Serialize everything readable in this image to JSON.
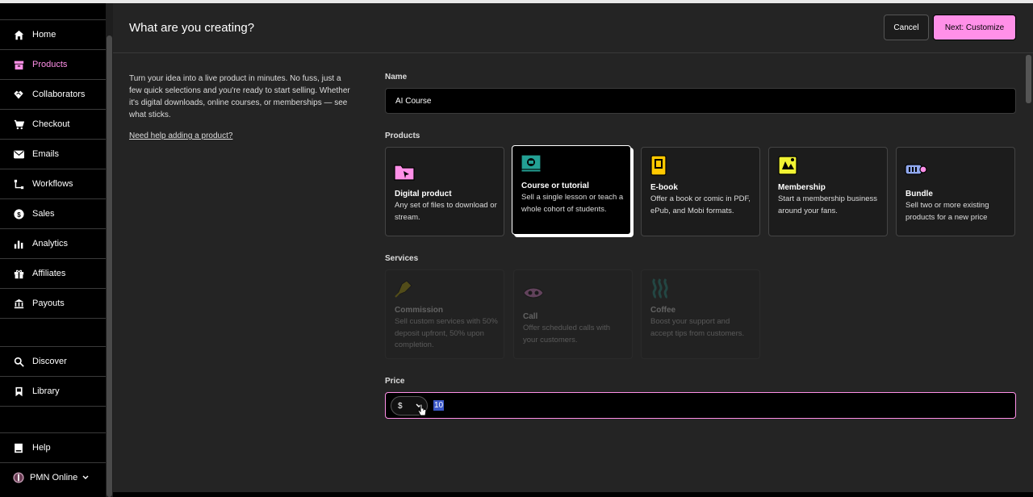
{
  "sidebar": {
    "items": [
      {
        "label": "Home",
        "icon": "home-icon"
      },
      {
        "label": "Products",
        "icon": "archive-icon",
        "active": true
      },
      {
        "label": "Collaborators",
        "icon": "handshake-icon"
      },
      {
        "label": "Checkout",
        "icon": "cart-icon"
      },
      {
        "label": "Emails",
        "icon": "envelope-icon"
      },
      {
        "label": "Workflows",
        "icon": "workflow-icon"
      },
      {
        "label": "Sales",
        "icon": "dollar-circle-icon"
      },
      {
        "label": "Analytics",
        "icon": "bar-chart-icon"
      },
      {
        "label": "Affiliates",
        "icon": "gift-icon"
      },
      {
        "label": "Payouts",
        "icon": "bank-icon"
      }
    ],
    "secondary": [
      {
        "label": "Discover",
        "icon": "search-icon"
      },
      {
        "label": "Library",
        "icon": "bookmark-icon"
      }
    ],
    "help": {
      "label": "Help",
      "icon": "book-icon"
    },
    "account": {
      "label": "PMN Online",
      "icon": "avatar"
    }
  },
  "header": {
    "title": "What are you creating?",
    "cancel_label": "Cancel",
    "next_label": "Next: Customize"
  },
  "intro": {
    "text": "Turn your idea into a live product in minutes. No fuss, just a few quick selections and you're ready to start selling. Whether it's digital downloads, online courses, or memberships — see what sticks.",
    "help_link": "Need help adding a product?"
  },
  "form": {
    "name_label": "Name",
    "name_value": "AI Course",
    "products_label": "Products",
    "products": [
      {
        "title": "Digital product",
        "desc": "Any set of files to download or stream.",
        "icon": "folder-icon"
      },
      {
        "title": "Course or tutorial",
        "desc": "Sell a single lesson or teach a whole cohort of students.",
        "icon": "course-icon",
        "selected": true
      },
      {
        "title": "E-book",
        "desc": "Offer a book or comic in PDF, ePub, and Mobi formats.",
        "icon": "ebook-icon"
      },
      {
        "title": "Membership",
        "desc": "Start a membership business around your fans.",
        "icon": "membership-icon"
      },
      {
        "title": "Bundle",
        "desc": "Sell two or more existing products for a new price",
        "icon": "bundle-icon"
      }
    ],
    "services_label": "Services",
    "services": [
      {
        "title": "Commission",
        "desc": "Sell custom services with 50% deposit upfront, 50% upon completion.",
        "icon": "commission-icon"
      },
      {
        "title": "Call",
        "desc": "Offer scheduled calls with your customers.",
        "icon": "call-icon"
      },
      {
        "title": "Coffee",
        "desc": "Boost your support and accept tips from customers.",
        "icon": "coffee-icon"
      }
    ],
    "price_label": "Price",
    "currency": "$",
    "price_value": "10"
  },
  "colors": {
    "accent": "#ff90e8",
    "main_bg": "#242424",
    "sidebar_bg": "#000000"
  }
}
